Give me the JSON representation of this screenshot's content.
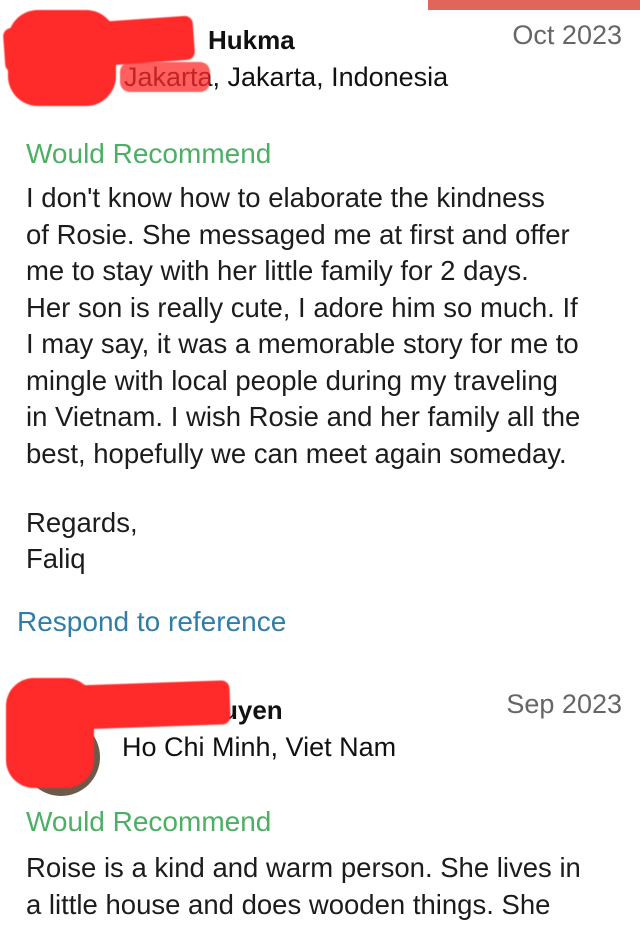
{
  "references": [
    {
      "name": "Hukma",
      "location": "Jakarta, Jakarta, Indonesia",
      "date": "Oct 2023",
      "recommendation": "Would Recommend",
      "body": "I don't know how to elaborate the kindness\nof Rosie. She messaged me at first and offer\nme to stay with her little family for 2 days.\nHer son is really cute, I adore him so much. If\nI may say, it was a memorable story for me to\nmingle with local people during my traveling\nin Vietnam. I wish Rosie and her family all the\nbest, hopefully we can meet again someday.",
      "regards": "Regards,",
      "signature": "Faliq",
      "respond_link": "Respond to reference"
    },
    {
      "name": "uyen",
      "location": "Ho Chi Minh, Viet Nam",
      "date": "Sep 2023",
      "recommendation": "Would Recommend",
      "body": "Roise is a kind and warm person. She lives in\na little house and does wooden things. She"
    }
  ],
  "colors": {
    "recommend": "#4caf63",
    "link": "#2f7ea8",
    "date": "#666666",
    "redaction": "#ff2a2a",
    "top_accent": "#e0655a"
  }
}
